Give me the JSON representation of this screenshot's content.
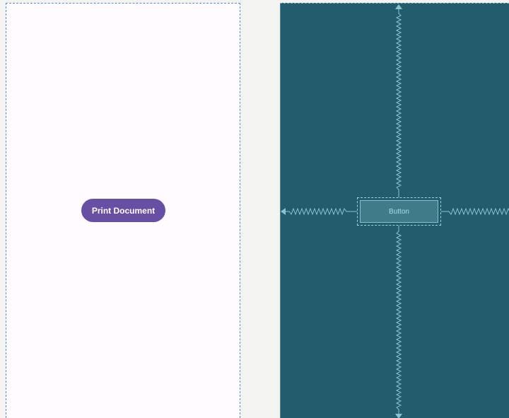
{
  "design_view": {
    "button_label": "Print Document"
  },
  "blueprint_view": {
    "button_label": "Button"
  },
  "colors": {
    "canvas_background": "#f3f3f2",
    "design_background": "#fffbfe",
    "button_fill": "#6750a4",
    "blueprint_background": "#235d6d",
    "constraint_line": "#8cc4ce"
  },
  "icons": [
    "constraint-top-icon",
    "constraint-bottom-icon",
    "constraint-left-icon",
    "constraint-right-icon"
  ]
}
